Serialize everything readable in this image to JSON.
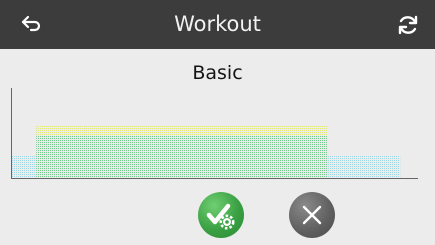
{
  "header": {
    "title": "Workout",
    "back_icon": "back-arrow-icon",
    "refresh_icon": "refresh-icon",
    "background_color": "#3c3c3c"
  },
  "workout": {
    "name": "Basic"
  },
  "profile": {
    "levels": [
      1,
      2,
      2,
      2,
      2,
      2,
      2,
      2,
      2,
      2,
      2,
      2,
      2,
      1,
      1,
      1
    ],
    "max_level": 2,
    "low_color": "#9fd8e6",
    "high_color": "#6fca8a",
    "top_color": "#e3e87a"
  },
  "actions": {
    "apply_icon": "check-gear-icon",
    "cancel_icon": "close-icon",
    "apply_color": "#3aa043",
    "cancel_color": "#5e5e5e"
  }
}
